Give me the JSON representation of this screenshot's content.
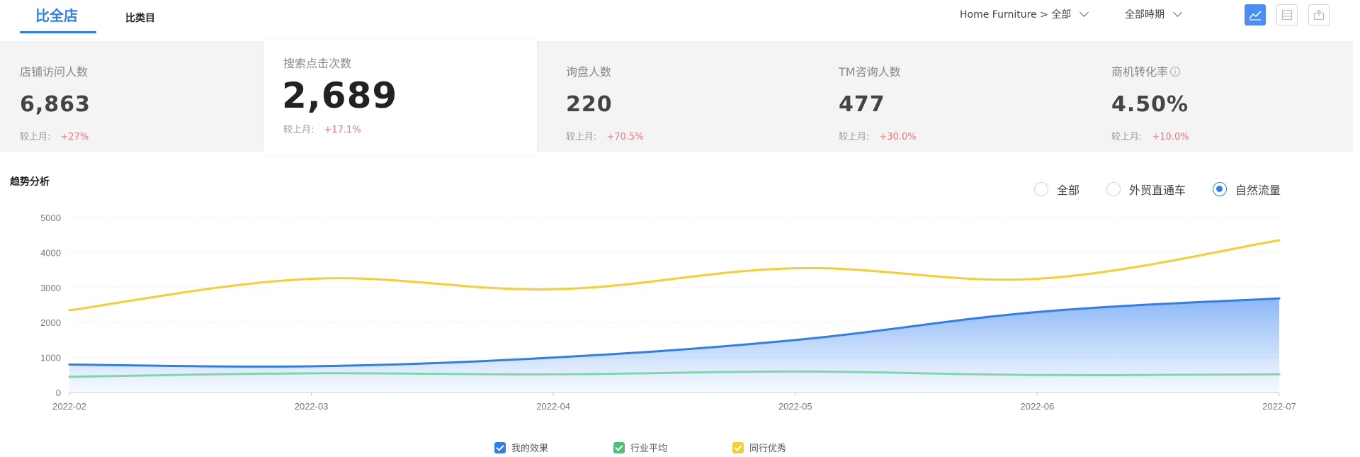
{
  "tabs": [
    {
      "label": "比全店",
      "active": true
    },
    {
      "label": "比类目",
      "active": false
    }
  ],
  "filters": {
    "category": "Home Furniture > 全部",
    "period": "全部時期"
  },
  "view_buttons": [
    {
      "icon": "line-chart-icon",
      "active": true
    },
    {
      "icon": "table-icon",
      "active": false
    },
    {
      "icon": "export-icon",
      "active": false
    }
  ],
  "metrics": [
    {
      "label": "店铺访问人数",
      "value": "6,863",
      "compare_label": "较上月:",
      "change": "+27%"
    },
    {
      "label": "搜索点击次数",
      "value": "2,689",
      "compare_label": "较上月:",
      "change": "+17.1%"
    },
    {
      "label": "询盘人数",
      "value": "220",
      "compare_label": "较上月:",
      "change": "+70.5%"
    },
    {
      "label": "TM咨询人数",
      "value": "477",
      "compare_label": "较上月:",
      "change": "+30.0%"
    },
    {
      "label": "商机转化率",
      "value": "4.50%",
      "compare_label": "较上月:",
      "change": "+10.0%"
    }
  ],
  "trend": {
    "title": "趋势分析",
    "radio_options": [
      {
        "label": "全部",
        "checked": false
      },
      {
        "label": "外贸直通车",
        "checked": false
      },
      {
        "label": "自然流量",
        "checked": true
      }
    ]
  },
  "chart_data": {
    "type": "line",
    "x": [
      "2022-02",
      "2022-03",
      "2022-04",
      "2022-05",
      "2022-06",
      "2022-07"
    ],
    "yticks": [
      0,
      1000,
      2000,
      3000,
      4000,
      5000
    ],
    "ylim": [
      0,
      5000
    ],
    "grid": true,
    "legend_position": "bottom",
    "series": [
      {
        "name": "我的效果",
        "values": [
          800,
          750,
          1000,
          1500,
          2300,
          2689
        ],
        "color": "#2f7ef0",
        "area": true
      },
      {
        "name": "行业平均",
        "values": [
          450,
          550,
          520,
          600,
          500,
          520
        ],
        "color": "#7fd7a7",
        "area": false
      },
      {
        "name": "同行优秀",
        "values": [
          2350,
          3250,
          2950,
          3550,
          3250,
          4350
        ],
        "color": "#f7cd2f",
        "area": false
      }
    ]
  }
}
